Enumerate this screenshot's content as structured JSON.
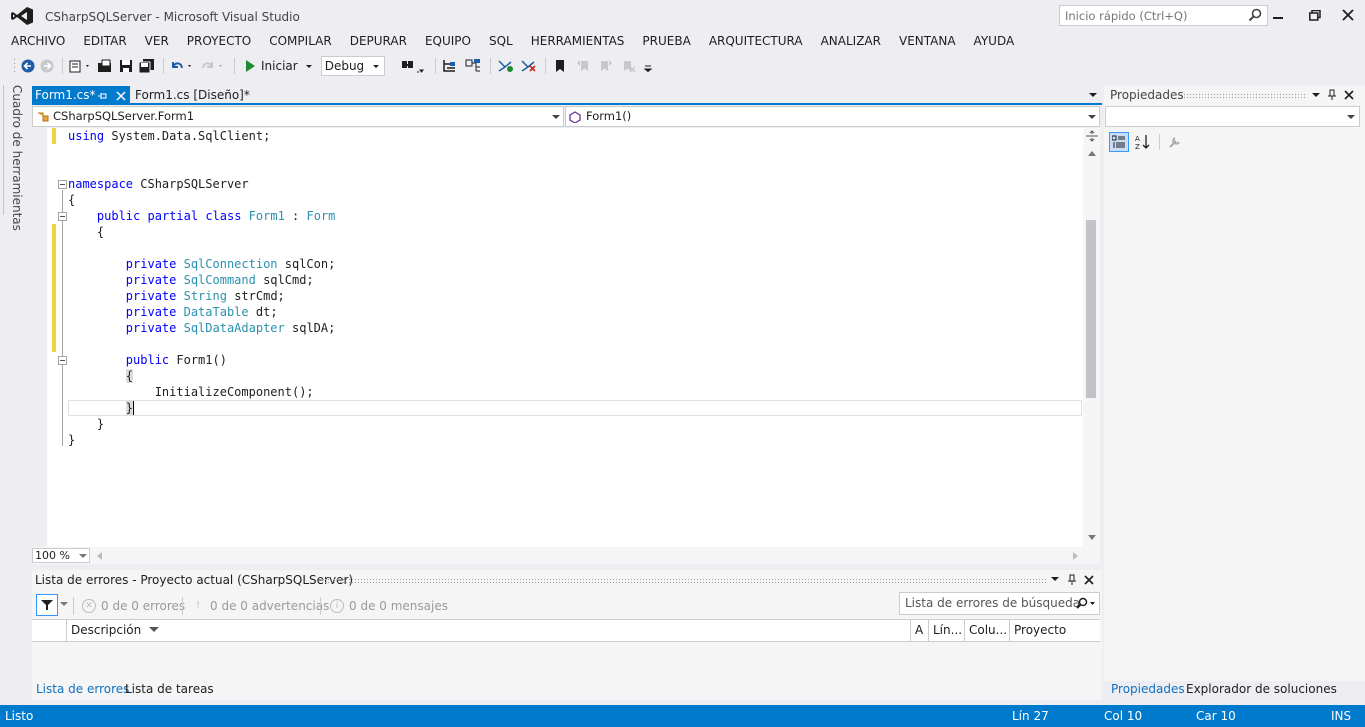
{
  "window": {
    "title": "CSharpSQLServer - Microsoft Visual Studio",
    "quick_launch_placeholder": "Inicio rápido (Ctrl+Q)"
  },
  "menu": [
    "ARCHIVO",
    "EDITAR",
    "VER",
    "PROYECTO",
    "COMPILAR",
    "DEPURAR",
    "EQUIPO",
    "SQL",
    "HERRAMIENTAS",
    "PRUEBA",
    "ARQUITECTURA",
    "ANALIZAR",
    "VENTANA",
    "AYUDA"
  ],
  "toolbar": {
    "start_label": "Iniciar",
    "config_value": "Debug"
  },
  "toolbox_tab": "Cuadro de herramientas",
  "tabs": {
    "active": "Form1.cs*",
    "inactive": "Form1.cs [Diseño]*"
  },
  "nav": {
    "type_dropdown": "CSharpSQLServer.Form1",
    "member_dropdown": "Form1()"
  },
  "code": [
    {
      "t": "using System.Data.SqlClient;"
    },
    {
      "t": ""
    },
    {
      "t": ""
    },
    {
      "t": "namespace CSharpSQLServer"
    },
    {
      "t": "{"
    },
    {
      "t": "    public partial class Form1 : Form"
    },
    {
      "t": "    {"
    },
    {
      "t": ""
    },
    {
      "t": "        private SqlConnection sqlCon;"
    },
    {
      "t": "        private SqlCommand sqlCmd;"
    },
    {
      "t": "        private String strCmd;"
    },
    {
      "t": "        private DataTable dt;"
    },
    {
      "t": "        private SqlDataAdapter sqlDA;"
    },
    {
      "t": ""
    },
    {
      "t": "        public Form1()"
    },
    {
      "t": "        {"
    },
    {
      "t": "            InitializeComponent();"
    },
    {
      "t": "        }"
    },
    {
      "t": "    }"
    },
    {
      "t": "}"
    }
  ],
  "zoom": "100 %",
  "error_list": {
    "title": "Lista de errores - Proyecto actual (CSharpSQLServer)",
    "errors": "0 de 0 errores",
    "warnings": "0 de 0 advertencias",
    "messages": "0 de 0 mensajes",
    "search_placeholder": "Lista de errores de búsqueda",
    "columns": [
      "Descripción",
      "A",
      "Lín...",
      "Colu...",
      "Proyecto"
    ]
  },
  "bottom_tabs": {
    "left_active": "Lista de errores",
    "left_inactive": "Lista de tareas",
    "right_active": "Propiedades",
    "right_inactive": "Explorador de soluciones"
  },
  "properties": {
    "title": "Propiedades"
  },
  "status": {
    "ready": "Listo",
    "line": "Lín 27",
    "col": "Col 10",
    "char": "Car 10",
    "mode": "INS"
  },
  "colors": {
    "accent": "#007acc",
    "keyword": "#0000ff",
    "type": "#2b91af",
    "changed": "#efd23d"
  }
}
